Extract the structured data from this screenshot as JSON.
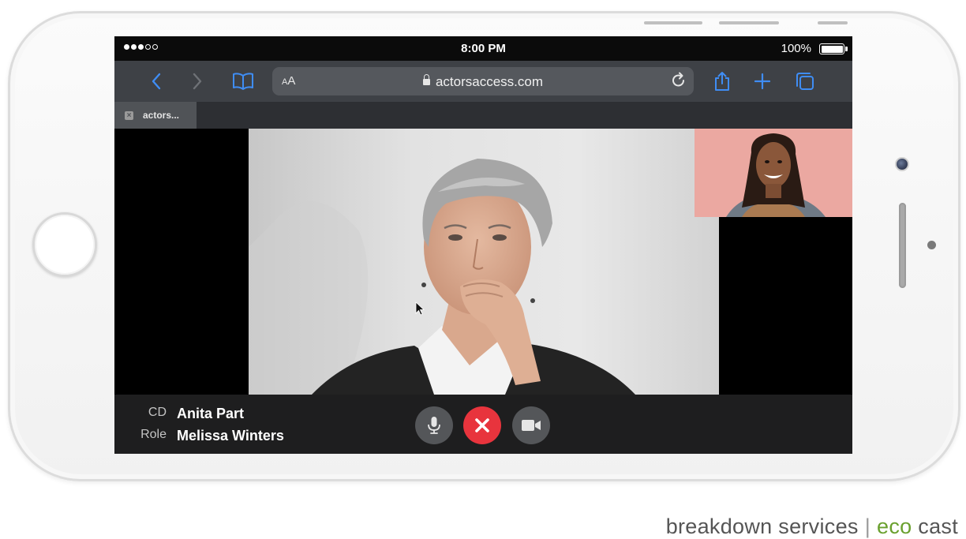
{
  "status_bar": {
    "time": "8:00 PM",
    "battery_text": "100%",
    "signal_bars_filled": 3,
    "signal_bars_total": 5
  },
  "browser": {
    "url_text": "actorsaccess.com",
    "text_size_label": "AA",
    "tab_title": "actors...",
    "accent_color": "#3f8df4",
    "icons": [
      "back-chevron-icon",
      "forward-chevron-icon",
      "bookmarks-book-icon",
      "lock-icon",
      "reload-icon",
      "share-icon",
      "plus-icon",
      "tabs-icon",
      "close-tab-icon"
    ]
  },
  "call": {
    "cd_label": "CD",
    "cd_name": "Anita Part",
    "role_label": "Role",
    "role_name": "Melissa Winters",
    "controls": [
      {
        "name": "microphone",
        "icon": "microphone-icon",
        "color": "#545659"
      },
      {
        "name": "end-call",
        "icon": "close-x-icon",
        "color": "#e8343d"
      },
      {
        "name": "camera",
        "icon": "video-camera-icon",
        "color": "#545659"
      }
    ]
  },
  "branding": {
    "part1": "breakdown services",
    "separator": "|",
    "part2": "eco",
    "part3": "cast",
    "eco_color": "#6aa02e"
  }
}
